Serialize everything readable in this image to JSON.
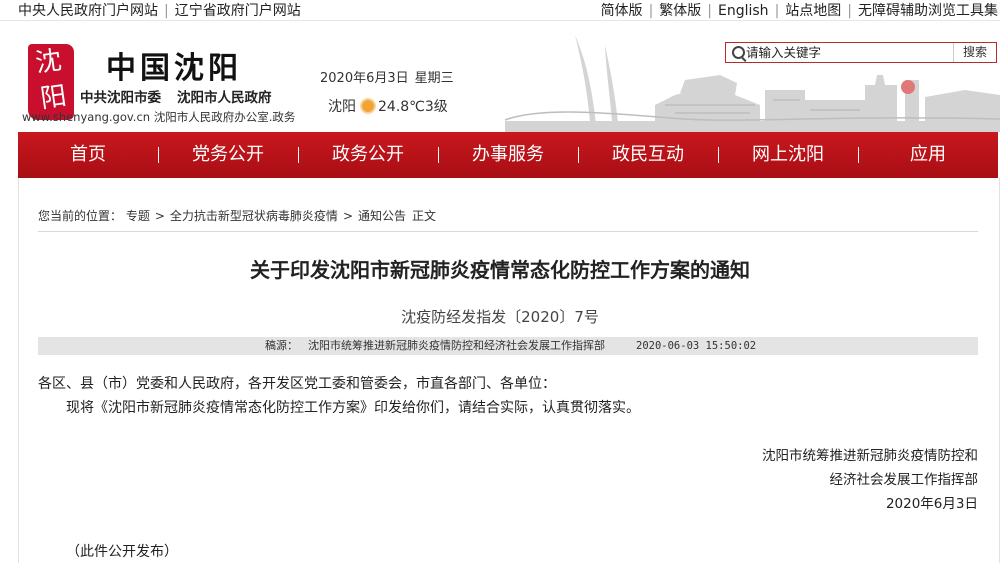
{
  "topbar": {
    "left_links": [
      "中央人民政府门户网站",
      "辽宁省政府门户网站"
    ],
    "right_links": [
      "简体版",
      "繁体版",
      "English",
      "站点地图",
      "无障碍辅助浏览工具集"
    ]
  },
  "header": {
    "site_name": "中国沈阳",
    "sub1": "中共沈阳市委",
    "sub2": "沈阳市人民政府",
    "url_text": "www.shenyang.gov.cn 沈阳市人民政府办公室.政务",
    "date": "2020年6月3日",
    "weekday": "星期三",
    "city": "沈阳",
    "weather": "24.8℃3级",
    "logo_seal_text": "沈阳"
  },
  "search": {
    "placeholder": "请输入关键字",
    "button_label": "搜索"
  },
  "nav": {
    "items": [
      "首页",
      "党务公开",
      "政务公开",
      "办事服务",
      "政民互动",
      "网上沈阳",
      "应用"
    ]
  },
  "breadcrumb": {
    "prefix": "您当前的位置：",
    "items": [
      "专题",
      "全力抗击新型冠状病毒肺炎疫情",
      "通知公告",
      "正文"
    ]
  },
  "article": {
    "title": "关于印发沈阳市新冠肺炎疫情常态化防控工作方案的通知",
    "doc_number": "沈疫防经发指发〔2020〕7号",
    "source_label": "稿源：",
    "source_org": "沈阳市统筹推进新冠肺炎疫情防控和经济社会发展工作指挥部",
    "source_time": "2020-06-03 15:50:02",
    "para1": "各区、县（市）党委和人民政府，各开发区党工委和管委会，市直各部门、各单位：",
    "para2": "现将《沈阳市新冠肺炎疫情常态化防控工作方案》印发给你们，请结合实际，认真贯彻落实。",
    "sign_line1": "沈阳市统筹推进新冠肺炎疫情防控和",
    "sign_line2": "经济社会发展工作指挥部",
    "sign_date": "2020年6月3日",
    "note": "（此件公开发布）"
  },
  "colors": {
    "nav_red": "#c8181e",
    "seal_red": "#c8102e"
  }
}
